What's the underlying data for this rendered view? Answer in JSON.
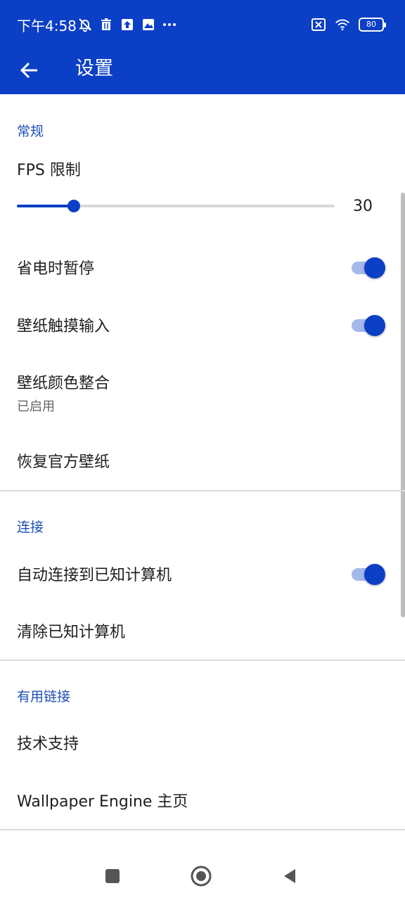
{
  "status_bar": {
    "time": "下午4:58",
    "battery_level": "80",
    "icons_left": [
      "notifications-off-icon",
      "trash-icon",
      "upload-icon",
      "image-icon",
      "more-icon"
    ],
    "icons_right": [
      "sim-off-icon",
      "wifi-icon",
      "battery-icon"
    ]
  },
  "toolbar": {
    "title": "设置",
    "back_icon": "arrow-back-icon"
  },
  "sections": {
    "general": {
      "header": "常规",
      "fps": {
        "title": "FPS 限制",
        "value_label": "30",
        "value_fraction": 0.18
      },
      "pause_on_battery_saver": {
        "title": "省电时暂停",
        "enabled": true
      },
      "wallpaper_touch_input": {
        "title": "壁纸触摸输入",
        "enabled": true
      },
      "wallpaper_color_integration": {
        "title": "壁纸颜色整合",
        "subtitle": "已启用"
      },
      "restore_official_wallpapers": {
        "title": "恢复官方壁纸"
      }
    },
    "connection": {
      "header": "连接",
      "auto_connect": {
        "title": "自动连接到已知计算机",
        "enabled": true
      },
      "clear_known": {
        "title": "清除已知计算机"
      }
    },
    "useful_links": {
      "header": "有用链接",
      "tech_support": {
        "title": "技术支持"
      },
      "homepage": {
        "title": "Wallpaper Engine 主页"
      }
    }
  },
  "nav_bar": {
    "icons": [
      "recents-square-icon",
      "home-circle-icon",
      "back-triangle-icon"
    ]
  },
  "colors": {
    "primary": "#0b3fc6",
    "section_header": "#1e4fb5",
    "switch_track": "#a5b8ea",
    "divider": "#dcdcdc"
  }
}
